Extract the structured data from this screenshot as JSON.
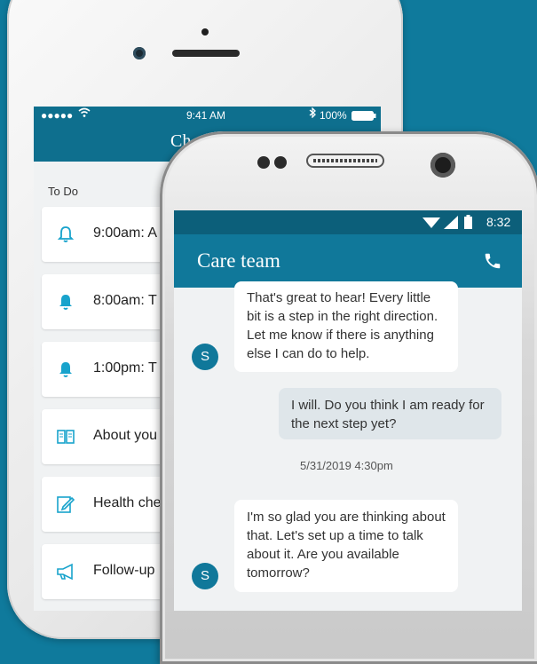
{
  "back_phone": {
    "status": {
      "signal": "●●●●● ",
      "time": "9:41 AM",
      "battery": "100%"
    },
    "header_title": "Ch",
    "section_label": "To Do",
    "tasks": [
      {
        "icon": "bell-outline-icon",
        "label": "9:00am: A"
      },
      {
        "icon": "bell-icon",
        "label": "8:00am: T"
      },
      {
        "icon": "bell-icon",
        "label": "1:00pm: T"
      },
      {
        "icon": "book-icon",
        "label": "About you"
      },
      {
        "icon": "edit-icon",
        "label": "Health che"
      },
      {
        "icon": "megaphone-icon",
        "label": "Follow-up"
      }
    ]
  },
  "front_phone": {
    "status": {
      "time": "8:32"
    },
    "header": {
      "title": "Care team",
      "call_icon": "phone-icon"
    },
    "messages": [
      {
        "from": "S",
        "side": "in",
        "text": "That's great to hear! Every little bit is a step in the right direction. Let me know if there is anything else I can do to help."
      },
      {
        "side": "out",
        "text": "I will. Do you think I am ready for the next step yet?"
      },
      {
        "timestamp": "5/31/2019 4:30pm"
      },
      {
        "from": "S",
        "side": "in",
        "text": "I'm so glad you are thinking about that. Let's set up a time to talk about it. Are you available tomorrow?"
      }
    ]
  },
  "colors": {
    "background": "#0f7a9c",
    "header": "#10789a",
    "accent_icon": "#18a3cc"
  }
}
